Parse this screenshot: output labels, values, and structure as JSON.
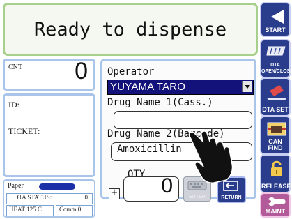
{
  "status": {
    "message": "Ready to dispense"
  },
  "left": {
    "cnt_label": "CNT",
    "cnt_value": "0",
    "id_label": "ID:",
    "ticket_label": "TICKET:",
    "paper_label": "Paper",
    "dta_status_label": "DTA STATUS:",
    "dta_status_value": "0",
    "heat_label": "HEAT 125  C",
    "comm_label": "Comm 0"
  },
  "form": {
    "operator_label": "Operator",
    "operator_value": "YUYAMA TARO",
    "drug1_label": "Drug Name 1(Cass.)",
    "drug1_value": "",
    "drug2_label": "Drug Name 2(Barcode)",
    "drug2_value": "Amoxicillin",
    "qty_label": "QTY",
    "qty_plus": "+",
    "qty_value": "0",
    "enter_label": "ENTER",
    "return_label": "RETURN"
  },
  "side_buttons": [
    {
      "label": "START",
      "icon": "play-triangle-icon"
    },
    {
      "label": "DTA OPEN/CLOSE",
      "icon": "tray-icon"
    },
    {
      "label": "DTA SET",
      "icon": "tray-set-icon"
    },
    {
      "label": "CAN FIND",
      "icon": "canister-icon"
    },
    {
      "label": "RELEASE",
      "icon": "padlock-icon"
    },
    {
      "label": "MAINT",
      "icon": "wrench-icon"
    }
  ],
  "colors": {
    "nav_blue": "#2a3d8c",
    "maint_purple": "#b35a9a",
    "select_navy": "#12127a",
    "banner_border": "#a8d08d",
    "panel_border": "#a9c6ea"
  }
}
